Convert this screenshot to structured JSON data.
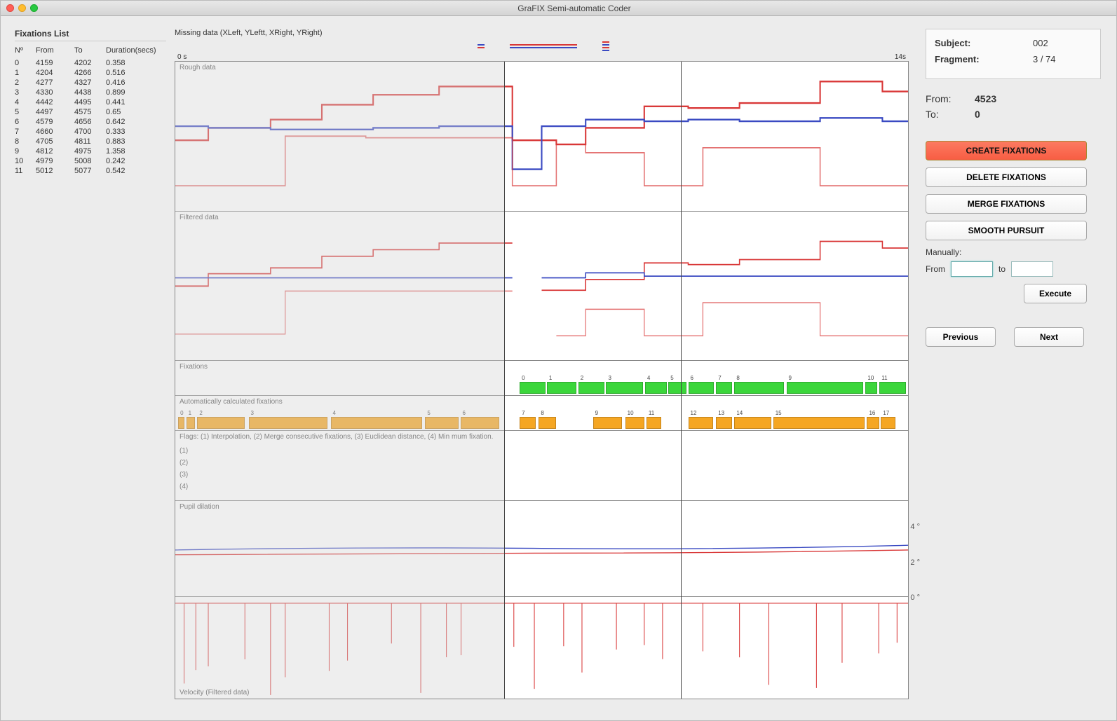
{
  "window_title": "GraFIX Semi-automatic Coder",
  "fixations_list": {
    "heading": "Fixations List",
    "columns": [
      "Nº",
      "From",
      "To",
      "Duration(secs)"
    ],
    "rows": [
      {
        "n": "0",
        "from": "4159",
        "to": "4202",
        "dur": "0.358"
      },
      {
        "n": "1",
        "from": "4204",
        "to": "4266",
        "dur": "0.516"
      },
      {
        "n": "2",
        "from": "4277",
        "to": "4327",
        "dur": "0.416"
      },
      {
        "n": "3",
        "from": "4330",
        "to": "4438",
        "dur": "0.899"
      },
      {
        "n": "4",
        "from": "4442",
        "to": "4495",
        "dur": "0.441"
      },
      {
        "n": "5",
        "from": "4497",
        "to": "4575",
        "dur": "0.65"
      },
      {
        "n": "6",
        "from": "4579",
        "to": "4656",
        "dur": "0.642"
      },
      {
        "n": "7",
        "from": "4660",
        "to": "4700",
        "dur": "0.333"
      },
      {
        "n": "8",
        "from": "4705",
        "to": "4811",
        "dur": "0.883"
      },
      {
        "n": "9",
        "from": "4812",
        "to": "4975",
        "dur": "1.358"
      },
      {
        "n": "10",
        "from": "4979",
        "to": "5008",
        "dur": "0.242"
      },
      {
        "n": "11",
        "from": "5012",
        "to": "5077",
        "dur": "0.542"
      }
    ]
  },
  "missing_label": "Missing data (XLeft, YLeftt, XRight, YRight)",
  "axis_start": "0 s",
  "axis_end": "14s",
  "panel_labels": {
    "rough": "Rough data",
    "filtered": "Filtered data",
    "fixations": "Fixations",
    "auto": "Automatically calculated fixations",
    "flags_title": "Flags: (1) Interpolation, (2) Merge consecutive fixations, (3) Euclidean distance, (4)  Min mum fixation.",
    "flag_1": "(1)",
    "flag_2": "(2)",
    "flag_3": "(3)",
    "flag_4": "(4)",
    "pupil": "Pupil dilation",
    "velocity": "Velocity (Filtered data)"
  },
  "fixation_numbers_top": [
    "0",
    "1",
    "2",
    "3",
    "4",
    "5",
    "6",
    "7",
    "8",
    "9",
    "10",
    "11"
  ],
  "auto_numbers": [
    "0",
    "1",
    "2",
    "3",
    "4",
    "5",
    "6",
    "7",
    "8",
    "9",
    "10",
    "11",
    "12",
    "13",
    "14",
    "15",
    "16",
    "17"
  ],
  "chart_data": {
    "type": "line",
    "x_range_seconds": [
      0,
      14
    ],
    "cursor_positions_pct": [
      44.9,
      69.0
    ],
    "selection_range_pct": [
      0,
      44.9
    ],
    "pupil_ticks_deg": [
      0,
      2,
      4
    ],
    "fixations_green": [
      {
        "n": "0",
        "from": 4159,
        "to": 4202,
        "start_pct": 47.0,
        "width_pct": 3.5
      },
      {
        "n": "1",
        "from": 4204,
        "to": 4266,
        "start_pct": 50.7,
        "width_pct": 4.0
      },
      {
        "n": "2",
        "from": 4277,
        "to": 4327,
        "start_pct": 55.0,
        "width_pct": 3.6
      },
      {
        "n": "3",
        "from": 4330,
        "to": 4438,
        "start_pct": 58.8,
        "width_pct": 5.0
      },
      {
        "n": "4",
        "from": 4442,
        "to": 4495,
        "start_pct": 64.1,
        "width_pct": 3.0
      },
      {
        "n": "5",
        "from": 4497,
        "to": 4575,
        "start_pct": 67.3,
        "width_pct": 2.5
      },
      {
        "n": "6",
        "from": 4579,
        "to": 4656,
        "start_pct": 70.0,
        "width_pct": 3.5
      },
      {
        "n": "7",
        "from": 4660,
        "to": 4700,
        "start_pct": 73.8,
        "width_pct": 2.2
      },
      {
        "n": "8",
        "from": 4705,
        "to": 4811,
        "start_pct": 76.3,
        "width_pct": 6.8
      },
      {
        "n": "9",
        "from": 4812,
        "to": 4975,
        "start_pct": 83.4,
        "width_pct": 10.5
      },
      {
        "n": "10",
        "from": 4979,
        "to": 5008,
        "start_pct": 94.2,
        "width_pct": 1.6
      },
      {
        "n": "11",
        "from": 5012,
        "to": 5077,
        "start_pct": 96.1,
        "width_pct": 3.6
      }
    ],
    "auto_fixations_orange": [
      {
        "n": "0",
        "start_pct": 0.4,
        "width_pct": 0.8
      },
      {
        "n": "1",
        "start_pct": 1.5,
        "width_pct": 1.2
      },
      {
        "n": "2",
        "start_pct": 3.0,
        "width_pct": 6.5
      },
      {
        "n": "3",
        "start_pct": 10.0,
        "width_pct": 10.8
      },
      {
        "n": "4",
        "start_pct": 21.2,
        "width_pct": 12.5
      },
      {
        "n": "5",
        "start_pct": 34.1,
        "width_pct": 4.6
      },
      {
        "n": "6",
        "start_pct": 38.9,
        "width_pct": 5.3
      },
      {
        "n": "7",
        "start_pct": 47.0,
        "width_pct": 2.2
      },
      {
        "n": "8",
        "start_pct": 49.6,
        "width_pct": 2.4
      },
      {
        "n": "9",
        "start_pct": 57.0,
        "width_pct": 4.0
      },
      {
        "n": "10",
        "start_pct": 61.4,
        "width_pct": 2.6
      },
      {
        "n": "11",
        "start_pct": 64.3,
        "width_pct": 2.0
      },
      {
        "n": "12",
        "start_pct": 70.0,
        "width_pct": 3.4
      },
      {
        "n": "13",
        "start_pct": 73.8,
        "width_pct": 2.2
      },
      {
        "n": "14",
        "start_pct": 76.3,
        "width_pct": 5.0
      },
      {
        "n": "15",
        "start_pct": 81.6,
        "width_pct": 12.5
      },
      {
        "n": "16",
        "start_pct": 94.4,
        "width_pct": 1.7
      },
      {
        "n": "17",
        "start_pct": 96.3,
        "width_pct": 2.0
      }
    ]
  },
  "sidebar": {
    "subject_label": "Subject:",
    "subject_value": "002",
    "fragment_label": "Fragment:",
    "fragment_value": "3 / 74",
    "from_label": "From:",
    "from_value": "4523",
    "to_label": "To:",
    "to_value": "0",
    "create_btn": "CREATE FIXATIONS",
    "delete_btn": "DELETE FIXATIONS",
    "merge_btn": "MERGE FIXATIONS",
    "smooth_btn": "SMOOTH PURSUIT",
    "manually_label": "Manually:",
    "manual_from": "From",
    "manual_to": "to",
    "execute": "Execute",
    "previous": "Previous",
    "next": "Next"
  },
  "pupil_ticks": {
    "t4": "4 °",
    "t2": "2 °",
    "t0": "0 °"
  }
}
